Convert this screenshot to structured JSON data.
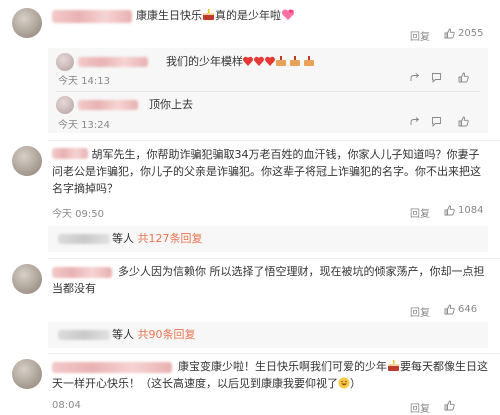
{
  "comments": [
    {
      "text_pre": "康康生日快乐",
      "text_post": "真的是少年啦",
      "likes": "2055",
      "reply_label": "回复",
      "sub_replies": [
        {
          "text": "我们的少年模样",
          "time": "今天 14:13",
          "reply_label": "回复"
        },
        {
          "text": "顶你上去",
          "time": "今天 13:24",
          "reply_label": "回复"
        }
      ]
    },
    {
      "name": "胡军先生",
      "text": "，你帮助诈骗犯骗取34万老百姓的血汗钱，你家人儿子知道吗？你妻子问老公是诈骗犯，你儿子的父亲是诈骗犯。你这辈子将冠上诈骗犯的名字。你不出来把这名字摘掉吗？",
      "time": "今天 09:50",
      "reply_label": "回复",
      "likes": "1084",
      "thread": {
        "suffix": "等人",
        "count": "共127条回复"
      }
    },
    {
      "text": "多少人因为信赖你 所以选择了悟空理财，现在被坑的倾家荡产，你却一点担当都没有",
      "reply_label": "回复",
      "likes": "646",
      "thread": {
        "suffix": "等人",
        "count": "共90条回复"
      }
    },
    {
      "text_pre": "康宝变康少啦！生日快乐啊我们可爱的少年",
      "text_post": "要每天都像生日这天一样开心快乐！（这长高速度，以后见到康康我要仰视了",
      "text_end": "）",
      "time": "08:04",
      "reply_label": "回复"
    }
  ],
  "icons": {
    "like": "thumb-up-icon",
    "reply": "reply-icon",
    "share": "share-icon"
  },
  "colors": {
    "link": "#eb7350",
    "muted": "#888888",
    "reply_bg": "#f7f7f7"
  }
}
